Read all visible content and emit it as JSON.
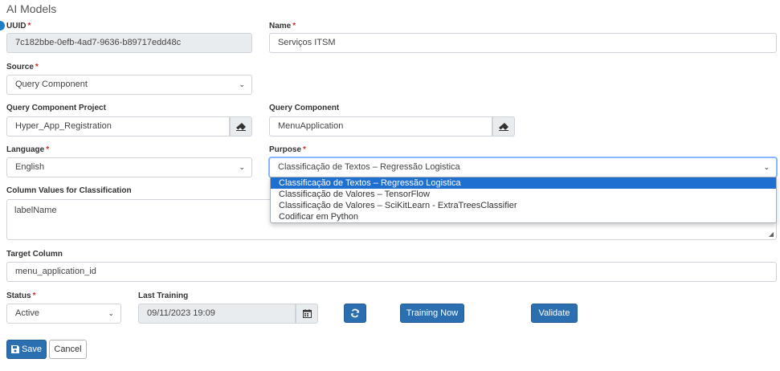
{
  "page": {
    "title": "AI Models"
  },
  "form": {
    "uuid": {
      "label": "UUID",
      "required": "*",
      "value": "7c182bbe-0efb-4ad7-9636-b89717edd48c"
    },
    "name": {
      "label": "Name",
      "required": "*",
      "value": "Serviços ITSM"
    },
    "source": {
      "label": "Source",
      "required": "*",
      "value": "Query Component"
    },
    "query_component_project": {
      "label": "Query Component Project",
      "value": "Hyper_App_Registration"
    },
    "query_component": {
      "label": "Query Component",
      "value": "MenuApplication"
    },
    "language": {
      "label": "Language",
      "required": "*",
      "value": "English"
    },
    "purpose": {
      "label": "Purpose",
      "required": "*",
      "value": "Classificação de Textos – Regressão Logistica",
      "options": [
        "Classificação de Textos – Regressão Logistica",
        "Classificação de Valores – TensorFlow",
        "Classificação de Valores – SciKitLearn - ExtraTreesClassifier",
        "Codificar em Python"
      ]
    },
    "column_values": {
      "label": "Column Values for Classification",
      "value": "labelName"
    },
    "target_column": {
      "label": "Target Column",
      "value": "menu_application_id"
    },
    "status": {
      "label": "Status",
      "required": "*",
      "value": "Active"
    },
    "last_training": {
      "label": "Last Training",
      "value": "09/11/2023 19:09"
    }
  },
  "buttons": {
    "training_now": "Training Now",
    "validate": "Validate",
    "save": "Save",
    "cancel": "Cancel"
  },
  "icons": {
    "clear": "eraser-icon",
    "calendar": "calendar-icon",
    "refresh": "refresh-icon",
    "save": "floppy-disk-icon",
    "dropdown": "chevron-down-icon"
  },
  "colors": {
    "primary": "#2c6fb0",
    "required": "#c9302c",
    "selected_option": "#1f6fd0",
    "readonly_bg": "#e9ecef"
  }
}
